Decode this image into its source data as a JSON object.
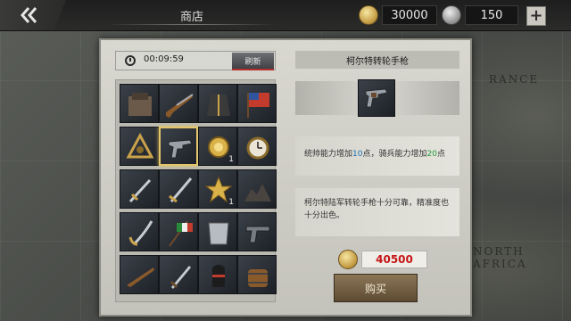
{
  "header": {
    "title": "商店",
    "gold": "30000",
    "medals": "150",
    "plus_label": "+"
  },
  "map_labels": [
    "RANCE",
    "NORTH AFRICA"
  ],
  "shop": {
    "timer": "00:09:59",
    "refresh_label": "刷新",
    "items": [
      {
        "icon": "hat-box-icon"
      },
      {
        "icon": "musket-icon"
      },
      {
        "icon": "uniform-jacket-icon"
      },
      {
        "icon": "flag-icon"
      },
      {
        "icon": "sextant-icon"
      },
      {
        "icon": "revolver-icon",
        "selected": true
      },
      {
        "icon": "gold-medal-icon",
        "count": "1"
      },
      {
        "icon": "pocket-watch-icon"
      },
      {
        "icon": "sword-icon"
      },
      {
        "icon": "sabre-icon"
      },
      {
        "icon": "star-medal-icon",
        "count": "1"
      },
      {
        "icon": "ore-pile-icon"
      },
      {
        "icon": "cavalry-sabre-icon"
      },
      {
        "icon": "banner-pole-icon"
      },
      {
        "icon": "breastplate-icon"
      },
      {
        "icon": "pistol-icon"
      },
      {
        "icon": "rifle-icon"
      },
      {
        "icon": "dagger-icon"
      },
      {
        "icon": "shako-helmet-icon"
      },
      {
        "icon": "barrel-icon"
      }
    ]
  },
  "detail": {
    "name": "柯尔特转轮手枪",
    "stat_prefix": "统帅能力增加",
    "stat_a_value": "10",
    "stat_mid": "点，骑兵能力增加",
    "stat_b_value": "20",
    "stat_suffix": "点",
    "description": "柯尔特陆军转轮手枪十分可靠，精准度也十分出色。",
    "price": "40500",
    "buy_label": "购买"
  },
  "colors": {
    "price": "#c41616",
    "stat_blue": "#1f6fb8",
    "stat_green": "#239b3b",
    "selection": "#e3c76a"
  }
}
